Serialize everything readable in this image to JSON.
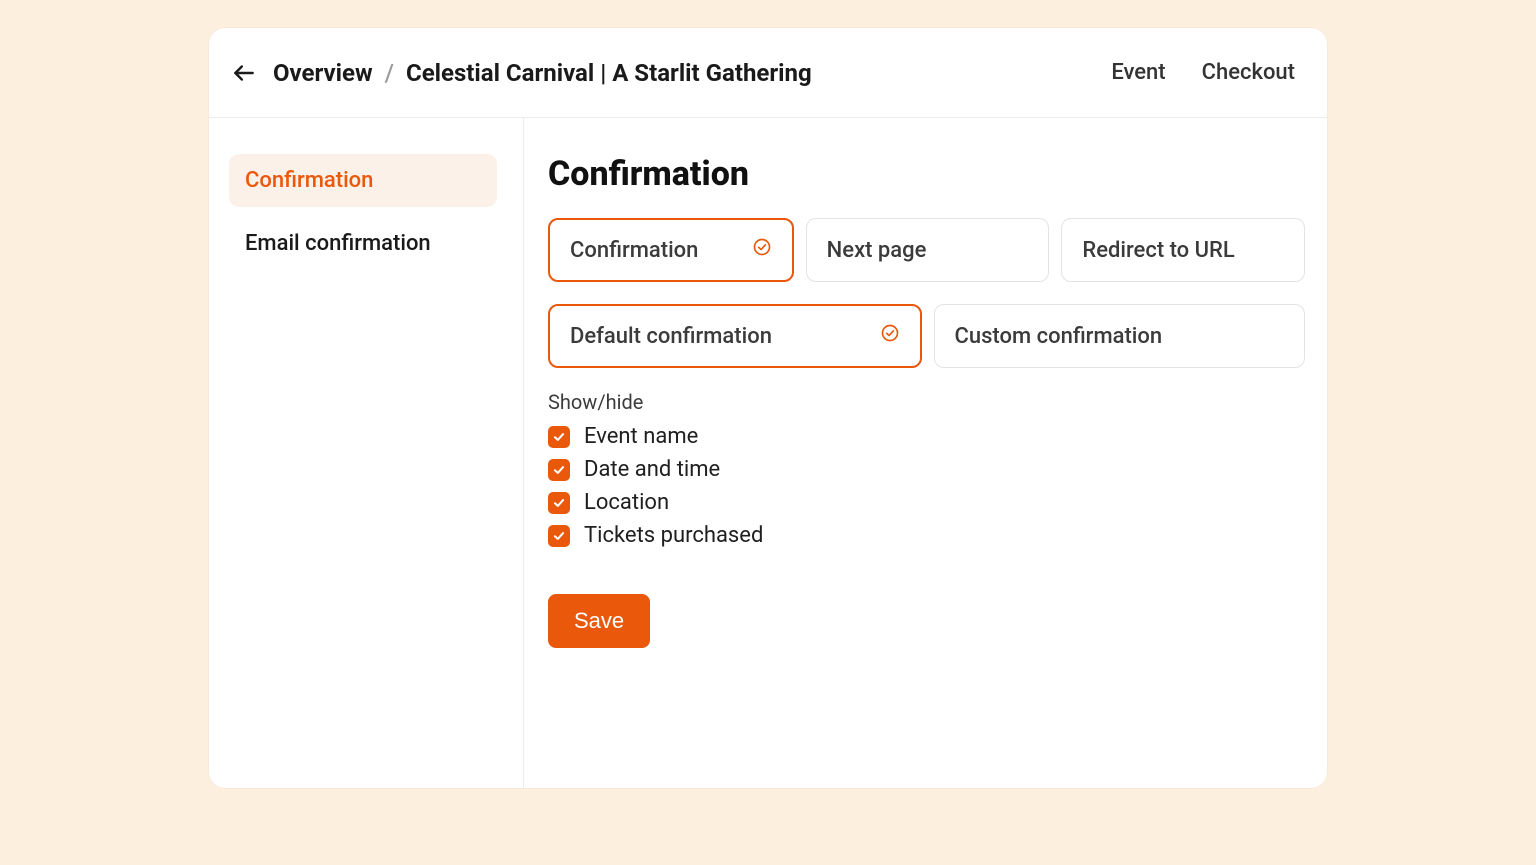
{
  "breadcrumb": {
    "overview": "Overview",
    "separator": "/",
    "title": "Celestial Carnival | A Starlit Gathering"
  },
  "topnav": {
    "event": "Event",
    "checkout": "Checkout"
  },
  "sidebar": {
    "items": [
      {
        "label": "Confirmation",
        "active": true
      },
      {
        "label": "Email confirmation",
        "active": false
      }
    ]
  },
  "main": {
    "heading": "Confirmation",
    "pageTypeOptions": {
      "confirmation": {
        "label": "Confirmation",
        "selected": true
      },
      "nextPage": {
        "label": "Next page",
        "selected": false
      },
      "redirect": {
        "label": "Redirect to URL",
        "selected": false
      }
    },
    "templateOptions": {
      "default": {
        "label": "Default confirmation",
        "selected": true
      },
      "custom": {
        "label": "Custom confirmation",
        "selected": false
      }
    },
    "showHide": {
      "label": "Show/hide",
      "items": [
        {
          "label": "Event name",
          "checked": true
        },
        {
          "label": "Date and time",
          "checked": true
        },
        {
          "label": "Location",
          "checked": true
        },
        {
          "label": "Tickets purchased",
          "checked": true
        }
      ]
    },
    "saveLabel": "Save"
  }
}
